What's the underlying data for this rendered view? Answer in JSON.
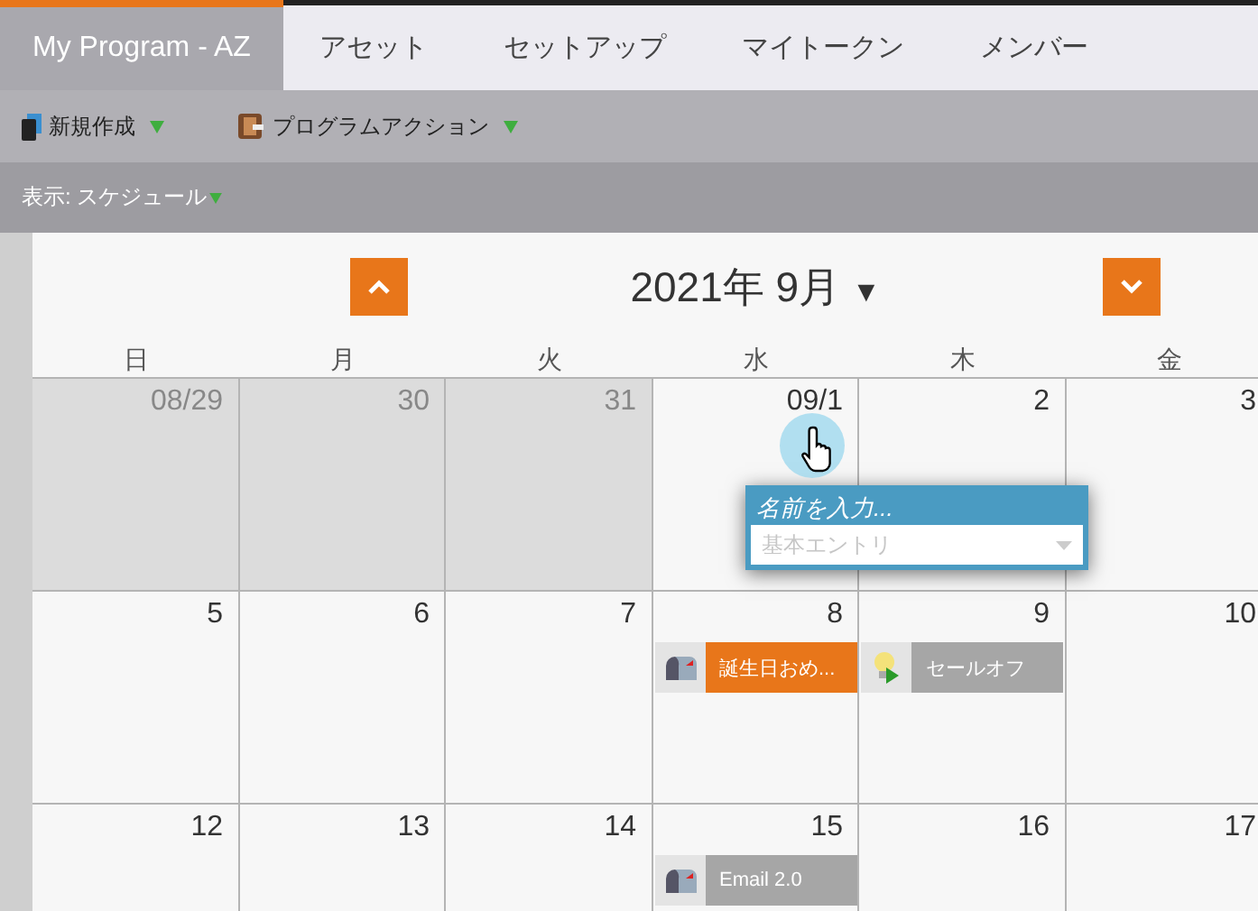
{
  "tabs": [
    {
      "label": "My Program - AZ",
      "selected": true
    },
    {
      "label": "アセット",
      "selected": false
    },
    {
      "label": "セットアップ",
      "selected": false
    },
    {
      "label": "マイトークン",
      "selected": false
    },
    {
      "label": "メンバー",
      "selected": false
    }
  ],
  "toolbar": [
    {
      "label": "新規作成",
      "kind": "new"
    },
    {
      "label": "プログラムアクション",
      "kind": "actions"
    }
  ],
  "view_bar": {
    "label": "表示: スケジュール"
  },
  "calendar": {
    "title": "2021年 9月",
    "title_caret": "▼",
    "weekdays": [
      "日",
      "月",
      "火",
      "水",
      "木",
      "金"
    ],
    "weeks": [
      {
        "days": [
          {
            "label": "08/29",
            "other_month": true
          },
          {
            "label": "30",
            "other_month": true
          },
          {
            "label": "31",
            "other_month": true
          },
          {
            "label": "09/1",
            "other_month": false
          },
          {
            "label": "2",
            "other_month": false
          },
          {
            "label": "3",
            "other_month": false
          }
        ]
      },
      {
        "days": [
          {
            "label": "5",
            "other_month": false
          },
          {
            "label": "6",
            "other_month": false
          },
          {
            "label": "7",
            "other_month": false
          },
          {
            "label": "8",
            "other_month": false,
            "events": [
              {
                "label": "誕生日おめ...",
                "kind": "email",
                "color": "#e8761a"
              }
            ]
          },
          {
            "label": "9",
            "other_month": false,
            "events": [
              {
                "label": "セールオフ",
                "kind": "idea",
                "color": "#a6a6a6"
              }
            ]
          },
          {
            "label": "10",
            "other_month": false
          }
        ]
      },
      {
        "days": [
          {
            "label": "12",
            "other_month": false
          },
          {
            "label": "13",
            "other_month": false
          },
          {
            "label": "14",
            "other_month": false
          },
          {
            "label": "15",
            "other_month": false,
            "events": [
              {
                "label": "Email 2.0",
                "kind": "email",
                "color": "#a6a6a6"
              }
            ]
          },
          {
            "label": "16",
            "other_month": false
          },
          {
            "label": "17",
            "other_month": false
          }
        ]
      }
    ],
    "popup": {
      "name_placeholder": "名前を入力...",
      "type_placeholder": "基本エントリ"
    }
  }
}
